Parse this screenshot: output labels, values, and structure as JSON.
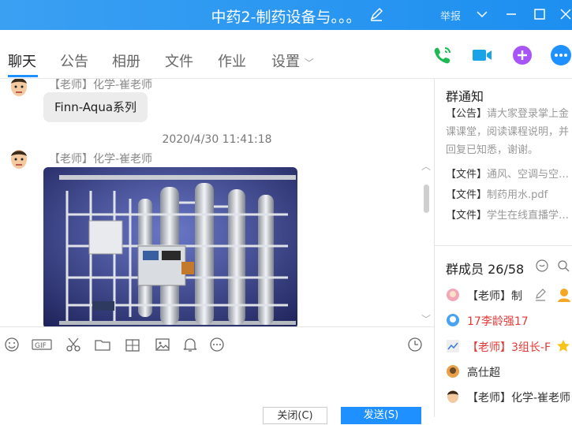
{
  "window": {
    "title": "中药2-制药设备与。。。",
    "report": "举报"
  },
  "tabs": [
    {
      "label": "聊天"
    },
    {
      "label": "公告"
    },
    {
      "label": "相册"
    },
    {
      "label": "文件"
    },
    {
      "label": "作业"
    },
    {
      "label": "设置"
    }
  ],
  "chat": {
    "messages": [
      {
        "sender": "【老师】化学-崔老师",
        "text": "Finn-Aqua系列"
      },
      {
        "timestamp": "2020/4/30 11:41:18",
        "sender": "【老师】化学-崔老师"
      }
    ]
  },
  "buttons": {
    "close": "关闭(C)",
    "send": "发送(S)"
  },
  "notice": {
    "title": "群通知",
    "announcement_tag": "【公告】",
    "announcement_text": "请大家登录掌上金课课堂，阅读课程说明，并回复已知悉，谢谢。",
    "files": [
      {
        "tag": "【文件】",
        "name": "通风、空调与空…"
      },
      {
        "tag": "【文件】",
        "name": "制药用水.pdf"
      },
      {
        "tag": "【文件】",
        "name": "学生在线直播学…"
      }
    ]
  },
  "members": {
    "header": "群成员 26/58",
    "list": [
      {
        "name": "【老师】制",
        "color": "#333333"
      },
      {
        "name": "17李龄强17",
        "color": "#e53935"
      },
      {
        "name": "【老师】3组长-F",
        "color": "#e53935"
      },
      {
        "name": "高仕超",
        "color": "#333333"
      },
      {
        "name": "【老师】化学-崔老师",
        "color": "#333333"
      }
    ]
  },
  "colors": {
    "accent": "#1e90ff",
    "phone": "#1db954",
    "video": "#1aa3e8",
    "add": "#a855f7"
  }
}
